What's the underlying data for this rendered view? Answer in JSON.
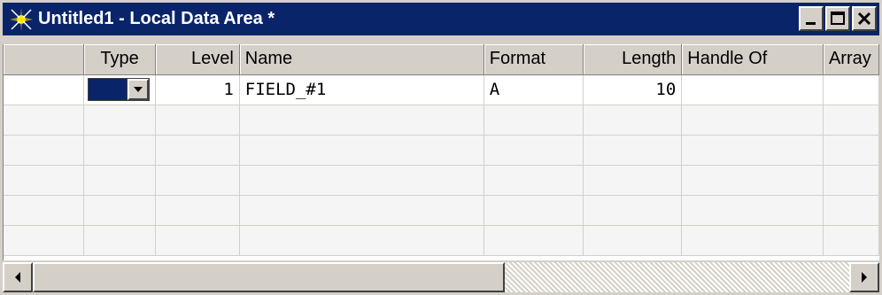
{
  "window": {
    "title": "Untitled1 - Local Data Area *",
    "icon": "star-sparkle-icon",
    "buttons": [
      "minimize-icon",
      "maximize-icon",
      "close-icon"
    ]
  },
  "grid": {
    "columns": [
      "",
      "Type",
      "Level",
      "Name",
      "Format",
      "Length",
      "Handle Of",
      "Array"
    ],
    "rows": [
      {
        "type_color": "#0a246a",
        "level": "1",
        "name": "FIELD_#1",
        "format": "A",
        "length": "10",
        "handle_of": "",
        "array": ""
      }
    ],
    "empty_rows": 5
  },
  "colors": {
    "title_bar": "#0a246a",
    "face": "#d4d0c8"
  }
}
